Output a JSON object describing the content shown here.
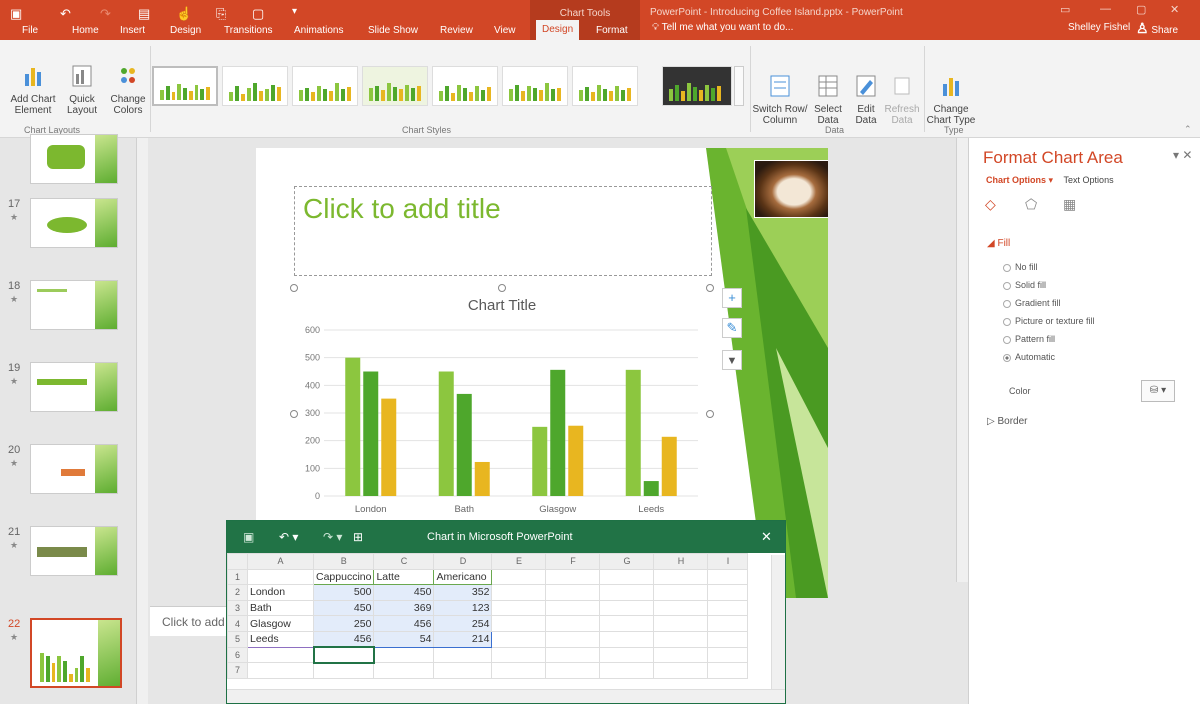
{
  "titlebar": {
    "context_tools": "Chart Tools",
    "document_title": "PowerPoint - Introducing Coffee Island.pptx - PowerPoint",
    "tabs": [
      "File",
      "Home",
      "Insert",
      "Design",
      "Transitions",
      "Animations",
      "Slide Show",
      "Review",
      "View",
      "Design",
      "Format"
    ],
    "tell_me": "Tell me what you want to do...",
    "user": "Shelley Fishel",
    "share": "Share",
    "accent": "#d24726"
  },
  "ribbon": {
    "add_chart_element": [
      "Add Chart",
      "Element"
    ],
    "quick_layout": [
      "Quick",
      "Layout"
    ],
    "change_colors": [
      "Change",
      "Colors"
    ],
    "switch_row_col": [
      "Switch Row/",
      "Column"
    ],
    "select_data": [
      "Select",
      "Data"
    ],
    "edit_data": [
      "Edit",
      "Data"
    ],
    "refresh_data": [
      "Refresh",
      "Data"
    ],
    "change_chart_type": [
      "Change",
      "Chart Type"
    ],
    "groups": {
      "layouts": "Chart Layouts",
      "styles": "Chart Styles",
      "data": "Data",
      "type": "Type"
    }
  },
  "slides": [
    {
      "num": "17",
      "star": "★"
    },
    {
      "num": "18",
      "star": "★"
    },
    {
      "num": "19",
      "star": "★"
    },
    {
      "num": "20",
      "star": "★"
    },
    {
      "num": "21",
      "star": "★"
    },
    {
      "num": "22",
      "star": "★"
    }
  ],
  "slide": {
    "title_placeholder": "Click to add title",
    "notes_placeholder": "Click to add notes"
  },
  "chart_data": {
    "type": "bar",
    "title": "Chart Title",
    "categories": [
      "London",
      "Bath",
      "Glasgow",
      "Leeds"
    ],
    "series": [
      {
        "name": "Cappuccino",
        "values": [
          500,
          450,
          250,
          456
        ],
        "color": "#8cc63f"
      },
      {
        "name": "Latte",
        "values": [
          450,
          369,
          456,
          54
        ],
        "color": "#4ea72c"
      },
      {
        "name": "Americano",
        "values": [
          352,
          123,
          254,
          214
        ],
        "color": "#e8b620"
      }
    ],
    "yticks": [
      "0",
      "100",
      "200",
      "300",
      "400",
      "500",
      "600"
    ],
    "ylim": [
      0,
      600
    ],
    "grid": true
  },
  "format_pane": {
    "title": "Format Chart Area",
    "tab_chart_options": "Chart Options",
    "tab_text_options": "Text Options",
    "fill_heading": "Fill",
    "fill_options": [
      "No fill",
      "Solid fill",
      "Gradient fill",
      "Picture or texture fill",
      "Pattern fill",
      "Automatic"
    ],
    "selected_fill": "Automatic",
    "color_label": "Color",
    "border_heading": "Border"
  },
  "sheet": {
    "title": "Chart in Microsoft PowerPoint",
    "columns": [
      "A",
      "B",
      "C",
      "D",
      "E",
      "F",
      "G",
      "H",
      "I"
    ],
    "rows": [
      [
        "",
        "Cappuccino",
        "Latte",
        "Americano"
      ],
      [
        "London",
        "500",
        "450",
        "352"
      ],
      [
        "Bath",
        "450",
        "369",
        "123"
      ],
      [
        "Glasgow",
        "250",
        "456",
        "254"
      ],
      [
        "Leeds",
        "456",
        "54",
        "214"
      ],
      [
        "",
        "",
        "",
        ""
      ],
      [
        "",
        "",
        "",
        ""
      ]
    ],
    "row_numbers": [
      "1",
      "2",
      "3",
      "4",
      "5",
      "6",
      "7"
    ]
  }
}
